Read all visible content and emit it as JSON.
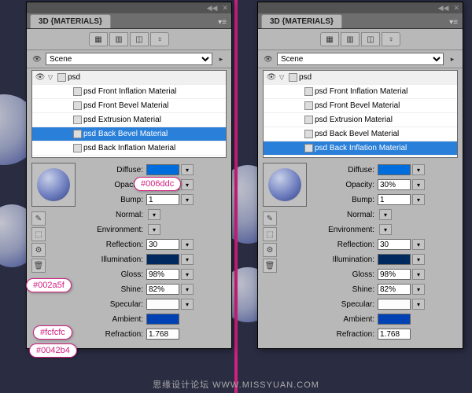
{
  "watermark": "思缘设计论坛  WWW.MISSYUAN.COM",
  "panels": {
    "left": {
      "title": "3D {MATERIALS}",
      "scene_label": "Scene",
      "root": "psd",
      "items": [
        "psd Front Inflation Material",
        "psd Front Bevel Material",
        "psd Extrusion Material",
        "psd Back Bevel Material",
        "psd Back Inflation Material"
      ],
      "selected_index": 3
    },
    "right": {
      "title": "3D {MATERIALS}",
      "scene_label": "Scene",
      "root": "psd",
      "items": [
        "psd Front Inflation Material",
        "psd Front Bevel Material",
        "psd Extrusion Material",
        "psd Back Bevel Material",
        "psd Back Inflation Material"
      ],
      "selected_index": 4
    }
  },
  "props": {
    "diffuse_label": "Diffuse:",
    "opacity_label": "Opacity:",
    "bump_label": "Bump:",
    "normal_label": "Normal:",
    "environment_label": "Environment:",
    "reflection_label": "Reflection:",
    "illumination_label": "Illumination:",
    "gloss_label": "Gloss:",
    "shine_label": "Shine:",
    "specular_label": "Specular:",
    "ambient_label": "Ambient:",
    "refraction_label": "Refraction:",
    "diffuse_color": "#006ddc",
    "opacity": "30%",
    "bump": "1",
    "reflection": "30",
    "illumination_color": "#002a5f",
    "gloss": "98%",
    "shine": "82%",
    "specular_color": "#fcfcfc",
    "ambient_color": "#0042b4",
    "refraction": "1.768"
  },
  "callouts": {
    "diffuse": "#006ddc",
    "illumination": "#002a5f",
    "specular": "#fcfcfc",
    "ambient": "#0042b4"
  }
}
